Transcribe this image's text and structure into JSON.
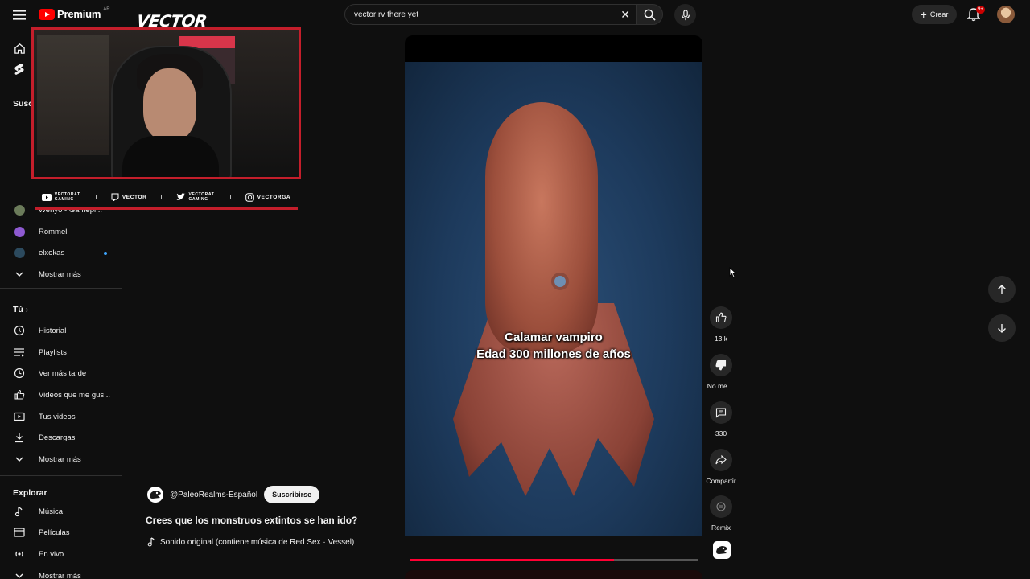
{
  "header": {
    "logo_text": "Premium",
    "logo_region": "AR",
    "search_value": "vector rv there yet",
    "create_label": "Crear",
    "notifications_badge": "9+"
  },
  "sidebar": {
    "subscriptions_heading": "Suscripciones",
    "subscriptions": [
      {
        "label": "Wenyo - Gamepl...",
        "avatar_color": "#6b7b5a"
      },
      {
        "label": "Rommel",
        "avatar_color": "#8e5ad1"
      },
      {
        "label": "elxokas",
        "avatar_color": "#2c4a5e",
        "live": true
      }
    ],
    "show_more": "Mostrar más",
    "you_heading": "Tú",
    "you_items": [
      {
        "label": "Historial",
        "icon": "history-icon"
      },
      {
        "label": "Playlists",
        "icon": "playlists-icon"
      },
      {
        "label": "Ver más tarde",
        "icon": "watch-later-icon"
      },
      {
        "label": "Videos que me gus...",
        "icon": "liked-icon"
      },
      {
        "label": "Tus videos",
        "icon": "your-videos-icon"
      },
      {
        "label": "Descargas",
        "icon": "downloads-icon"
      }
    ],
    "you_show_more": "Mostrar más",
    "explore_heading": "Explorar",
    "explore_items": [
      {
        "label": "Música",
        "icon": "music-icon"
      },
      {
        "label": "Películas",
        "icon": "movies-icon"
      },
      {
        "label": "En vivo",
        "icon": "live-icon"
      }
    ],
    "explore_show_more": "Mostrar más"
  },
  "overlay": {
    "brand": "VECTOR",
    "socials": [
      {
        "icon": "youtube-icon",
        "label": "VECTORAT GAMING"
      },
      {
        "icon": "twitch-icon",
        "label": "VECTOR"
      },
      {
        "icon": "twitter-icon",
        "label": "VECTORAT GAMING"
      },
      {
        "icon": "instagram-icon",
        "label": "VECTORGA"
      }
    ]
  },
  "video": {
    "caption_line1": "Calamar vampiro",
    "caption_line2": "Edad 300 millones de años",
    "progress": 0.71,
    "channel_handle": "@PaleoRealms-Español",
    "subscribe_label": "Suscribirse",
    "title": "Crees que los monstruos extintos se han ido?",
    "sound": "Sonido original (contiene música de Red Sex · Vessel)"
  },
  "actions": {
    "like_count": "13 k",
    "dislike_label": "No me ...",
    "comments_count": "330",
    "share_label": "Compartir",
    "remix_label": "Remix"
  },
  "colors": {
    "accent_red": "#ff0000",
    "overlay_red": "#c41e2b",
    "progress_red": "#ff0033",
    "background": "#0f0f0f"
  }
}
